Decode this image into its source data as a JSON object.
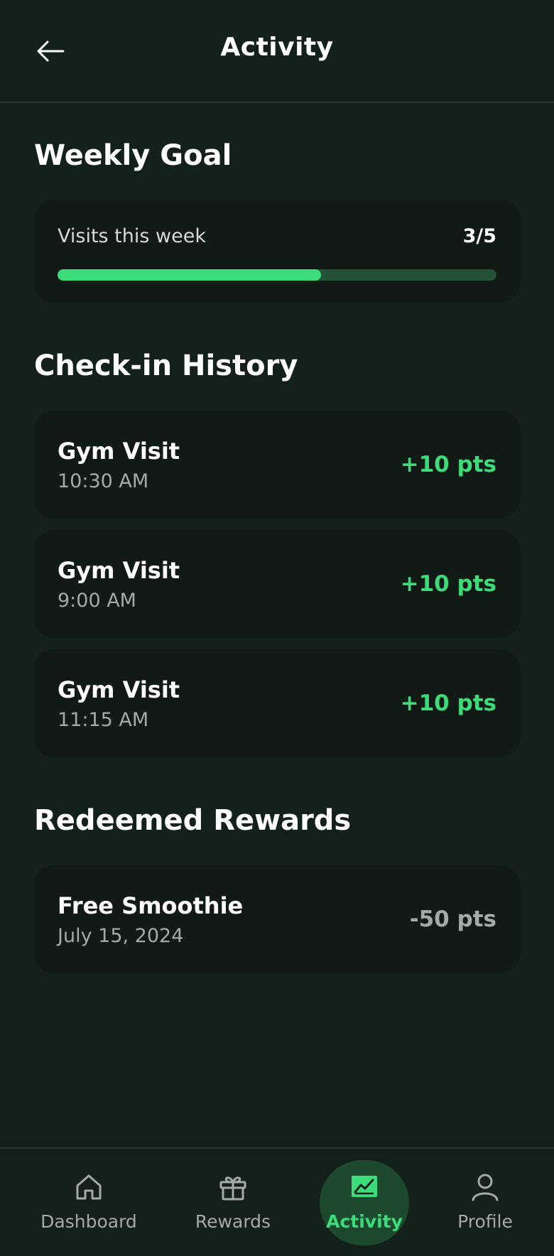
{
  "header": {
    "title": "Activity"
  },
  "weekly_goal": {
    "title": "Weekly Goal",
    "label": "Visits this week",
    "value": "3/5",
    "progress": 0.6
  },
  "history": {
    "title": "Check-in History",
    "items": [
      {
        "title": "Gym Visit",
        "time": "10:30 AM",
        "points": "+10 pts"
      },
      {
        "title": "Gym Visit",
        "time": "9:00 AM",
        "points": "+10 pts"
      },
      {
        "title": "Gym Visit",
        "time": "11:15 AM",
        "points": "+10 pts"
      }
    ]
  },
  "rewards": {
    "title": "Redeemed Rewards",
    "items": [
      {
        "title": "Free Smoothie",
        "date": "July 15, 2024",
        "points": "-50 pts"
      }
    ]
  },
  "nav": {
    "items": [
      {
        "label": "Dashboard",
        "icon": "home-icon"
      },
      {
        "label": "Rewards",
        "icon": "gift-icon"
      },
      {
        "label": "Activity",
        "icon": "chart-icon",
        "active": true
      },
      {
        "label": "Profile",
        "icon": "user-icon"
      }
    ]
  },
  "colors": {
    "background": "#14201a",
    "card": "#111a15",
    "accent": "#3ddc7a",
    "muted": "#a3aba6"
  }
}
